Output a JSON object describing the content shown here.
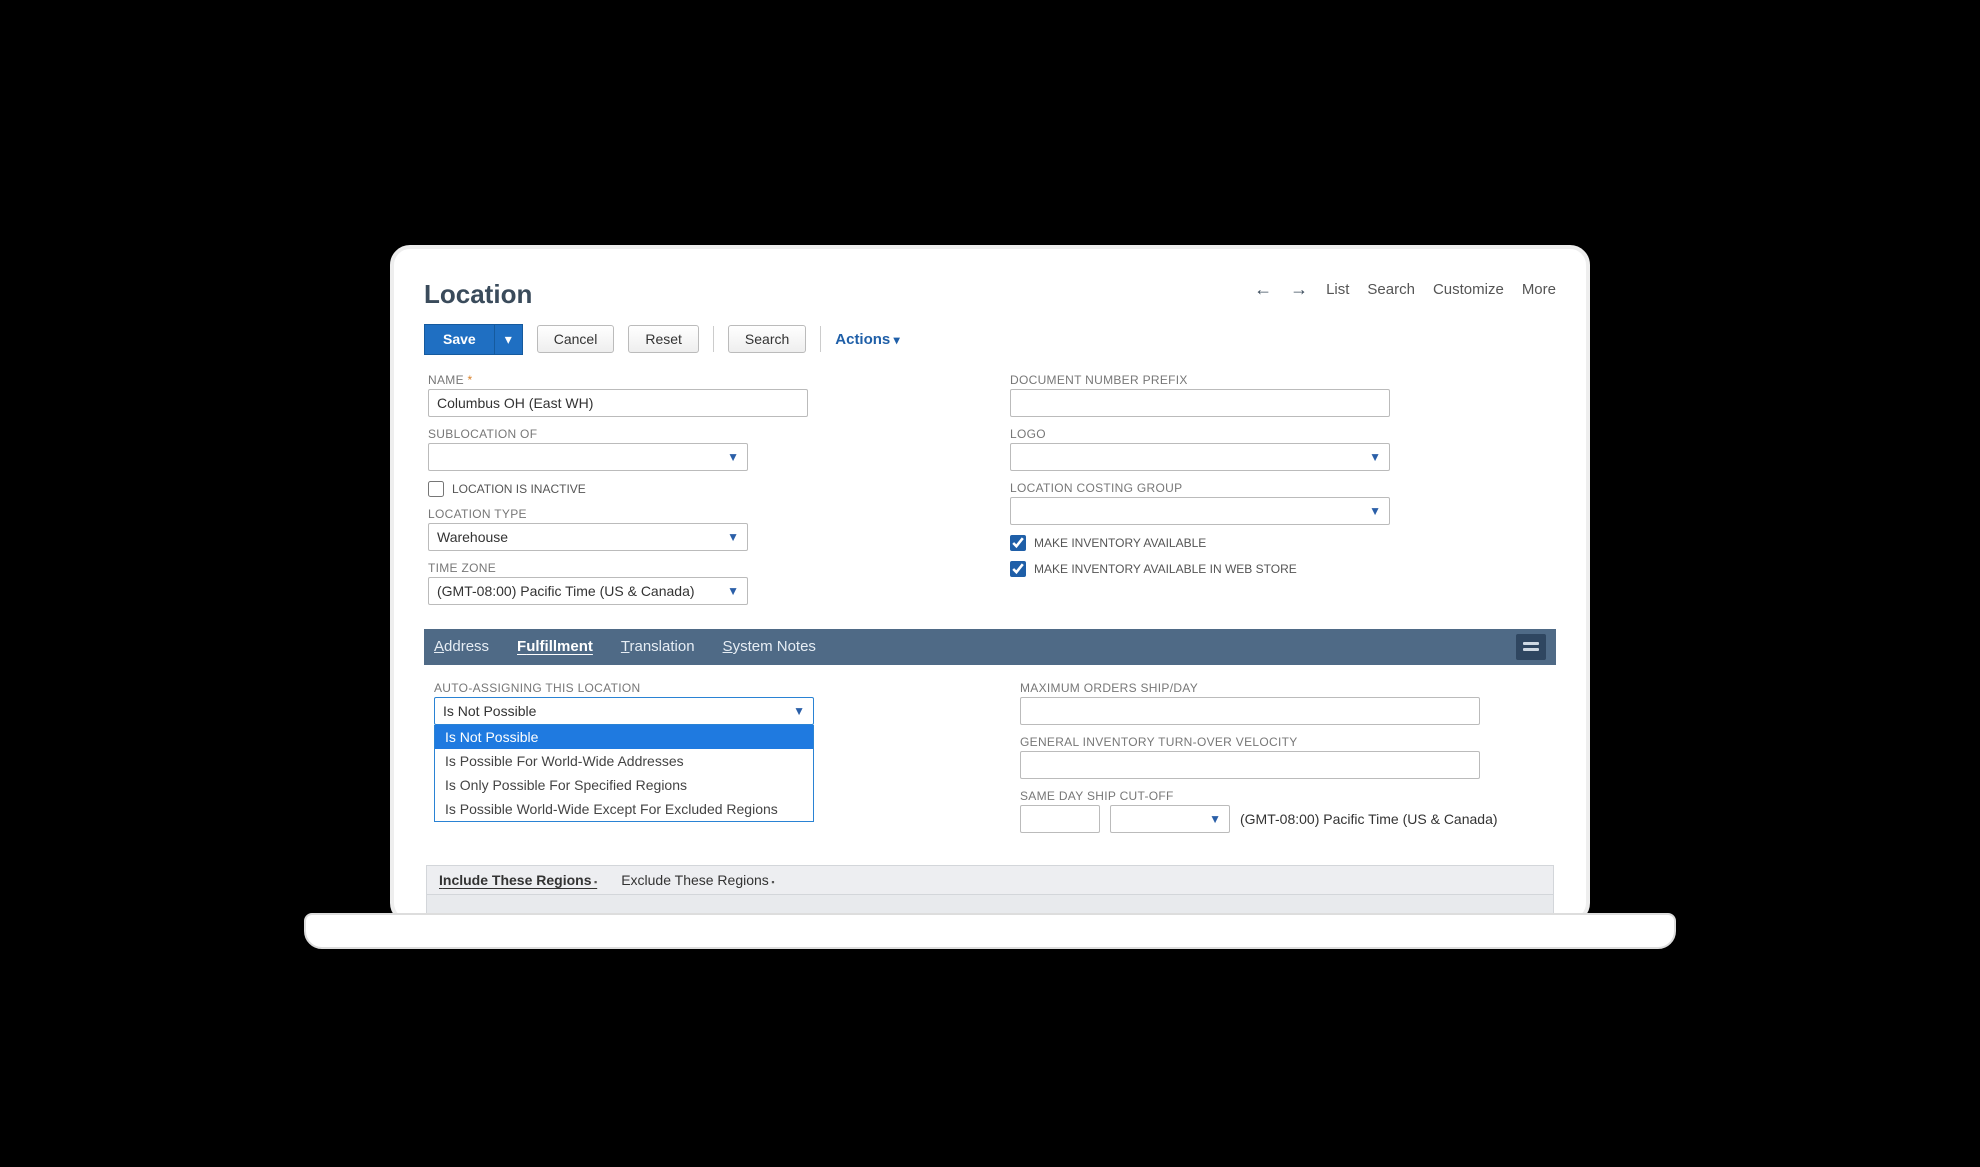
{
  "page": {
    "title": "Location"
  },
  "nav": {
    "list": "List",
    "search": "Search",
    "customize": "Customize",
    "more": "More"
  },
  "toolbar": {
    "save": "Save",
    "cancel": "Cancel",
    "reset": "Reset",
    "search": "Search",
    "actions": "Actions"
  },
  "left": {
    "name_label": "NAME",
    "name_value": "Columbus OH (East WH)",
    "sublocation_label": "SUBLOCATION OF",
    "sublocation_value": "",
    "inactive_label": "LOCATION IS INACTIVE",
    "inactive_checked": false,
    "type_label": "LOCATION TYPE",
    "type_value": "Warehouse",
    "tz_label": "TIME ZONE",
    "tz_value": "(GMT-08:00) Pacific Time (US & Canada)"
  },
  "right": {
    "docprefix_label": "DOCUMENT NUMBER PREFIX",
    "docprefix_value": "",
    "logo_label": "LOGO",
    "logo_value": "",
    "costgroup_label": "LOCATION COSTING GROUP",
    "costgroup_value": "",
    "inv_avail_label": "MAKE INVENTORY AVAILABLE",
    "inv_avail_checked": true,
    "inv_web_label": "MAKE INVENTORY AVAILABLE IN WEB STORE",
    "inv_web_checked": true
  },
  "tabs": {
    "address": "Address",
    "fulfillment": "Fulfillment",
    "translation": "Translation",
    "system_notes": "System Notes",
    "active": "fulfillment"
  },
  "fulfillment": {
    "autoassign_label": "AUTO-ASSIGNING THIS LOCATION",
    "autoassign_value": "Is Not Possible",
    "autoassign_options": [
      "Is Not Possible",
      "Is Possible For World-Wide Addresses",
      "Is Only Possible For Specified Regions",
      "Is Possible World-Wide Except For Excluded Regions"
    ],
    "max_orders_label": "MAXIMUM ORDERS SHIP/DAY",
    "max_orders_value": "",
    "velocity_label": "GENERAL INVENTORY TURN-OVER VELOCITY",
    "velocity_value": "",
    "cutoff_label": "SAME DAY SHIP CUT-OFF",
    "cutoff_hour": "",
    "cutoff_min": "",
    "cutoff_tz_note": "(GMT-08:00) Pacific Time (US & Canada)"
  },
  "regions": {
    "include": "Include These Regions",
    "exclude": "Exclude These Regions"
  }
}
